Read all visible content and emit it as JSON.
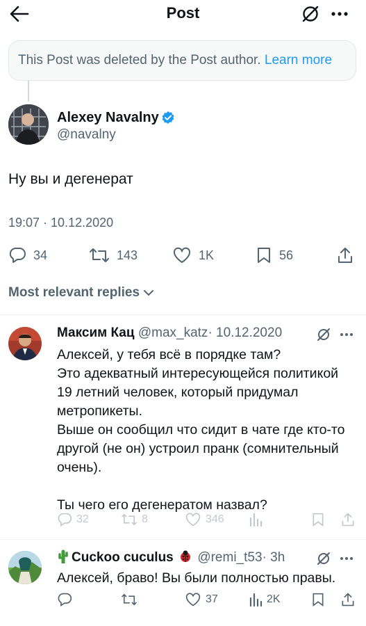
{
  "header": {
    "title": "Post",
    "back_icon": "arrow-left-icon",
    "grok_icon": "slash-circle-icon",
    "more_icon": "more-dots-icon"
  },
  "notice": {
    "text": "This Post was deleted by the Post author.",
    "link": "Learn more",
    "link_color": "#1d9bf0"
  },
  "post": {
    "author_name": "Alexey Navalny",
    "author_handle": "@navalny",
    "text": "Ну вы и дегенерат",
    "timestamp": "19:07 · 10.12.2020",
    "replies": "34",
    "reposts": "143",
    "likes": "1K",
    "bookmarks": "56"
  },
  "replies_filter": {
    "label": "Most relevant replies"
  },
  "replies": [
    {
      "name": "Максим Кац",
      "handle": "@max_katz",
      "date": "· 10.12.2020",
      "text": "Алексей, у тебя всё в порядке там?\nЭто адекватный интересующейся политикой 19 летний человек, который придумал метропикеты.\nВыше он сообщил что сидит в чате где кто-то другой (не он) устроил пранк (сомнительный очень).\n\nТы чего его дегенератом назвал?",
      "replies": "32",
      "reposts": "8",
      "likes": "346",
      "views": ""
    },
    {
      "name": "Cuckoo cuculus",
      "handle": "@remi_t53",
      "date": "· 3h",
      "text": "Алексей, браво! Вы были полностью правы.",
      "replies": "",
      "reposts": "",
      "likes": "37",
      "views": "2K"
    }
  ],
  "colors": {
    "accent": "#1d9bf0",
    "secondary_text": "#536471",
    "cactus": "#3e9a3a"
  }
}
